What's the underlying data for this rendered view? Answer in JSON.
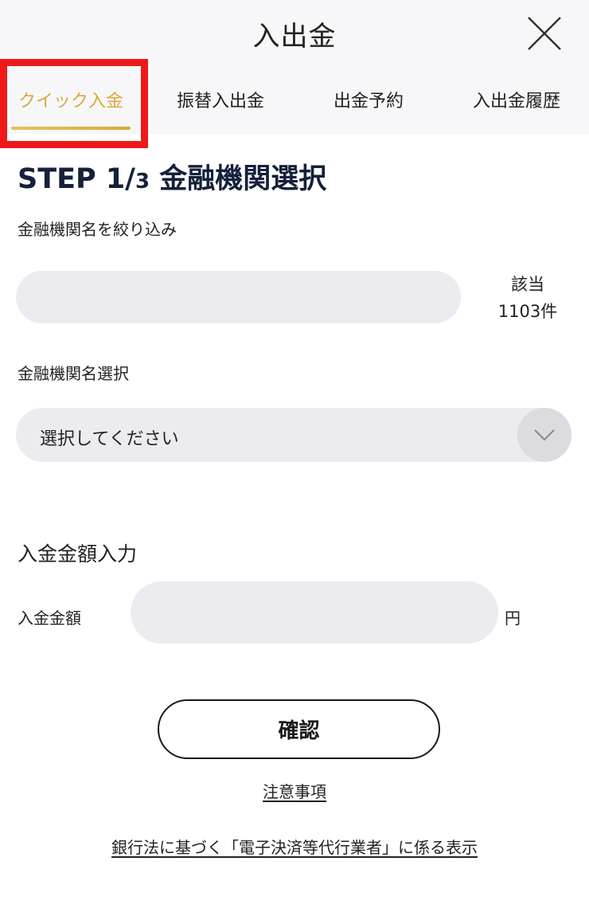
{
  "header": {
    "title": "入出金",
    "close_icon": "close-icon"
  },
  "tabs": [
    {
      "label": "クイック入金",
      "active": true
    },
    {
      "label": "振替入出金",
      "active": false
    },
    {
      "label": "出金予約",
      "active": false
    },
    {
      "label": "入出金履歴",
      "active": false
    }
  ],
  "colors": {
    "accent": "#d9a93a",
    "highlight": "#ee1a1a",
    "title": "#15203a",
    "field_bg": "#ececf0"
  },
  "step": {
    "prefix": "STEP 1/",
    "number": "3",
    "title": "金融機関選択"
  },
  "filter": {
    "label": "金融機関名を絞り込み",
    "value": "",
    "count_label": "該当",
    "count_value": "1103件"
  },
  "bank_select": {
    "label": "金融機関名選択",
    "selected": "選択してください",
    "chevron_icon": "chevron-down-icon"
  },
  "amount": {
    "section_title": "入金金額入力",
    "label": "入金金額",
    "value": "",
    "unit": "円"
  },
  "actions": {
    "confirm_label": "確認",
    "notes_link": "注意事項",
    "disclosure_link": "銀行法に基づく「電子決済等代行業者」に係る表示"
  }
}
